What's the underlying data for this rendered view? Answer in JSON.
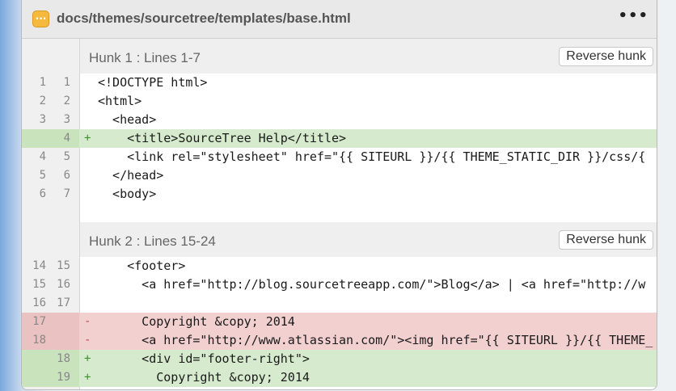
{
  "file": {
    "path": "docs/themes/sourcetree/templates/base.html",
    "icon": "ellipsis-file-icon",
    "menu": "•••"
  },
  "hunks": [
    {
      "title": "Hunk 1 : Lines 1-7",
      "button": "Reverse hunk",
      "lines": [
        {
          "old": "1",
          "new": "1",
          "type": "ctx",
          "sign": "",
          "text": "<!DOCTYPE html>"
        },
        {
          "old": "2",
          "new": "2",
          "type": "ctx",
          "sign": "",
          "text": "<html>"
        },
        {
          "old": "3",
          "new": "3",
          "type": "ctx",
          "sign": "",
          "text": "  <head>"
        },
        {
          "old": "",
          "new": "4",
          "type": "add",
          "sign": "+",
          "text": "    <title>SourceTree Help</title>"
        },
        {
          "old": "4",
          "new": "5",
          "type": "ctx",
          "sign": "",
          "text": "    <link rel=\"stylesheet\" href=\"{{ SITEURL }}/{{ THEME_STATIC_DIR }}/css/{"
        },
        {
          "old": "5",
          "new": "6",
          "type": "ctx",
          "sign": "",
          "text": "  </head>"
        },
        {
          "old": "6",
          "new": "7",
          "type": "ctx",
          "sign": "",
          "text": "  <body>"
        }
      ]
    },
    {
      "title": "Hunk 2 : Lines 15-24",
      "button": "Reverse hunk",
      "lines": [
        {
          "old": "14",
          "new": "15",
          "type": "ctx",
          "sign": "",
          "text": "    <footer>"
        },
        {
          "old": "15",
          "new": "16",
          "type": "ctx",
          "sign": "",
          "text": "      <a href=\"http://blog.sourcetreeapp.com/\">Blog</a> | <a href=\"http://w"
        },
        {
          "old": "16",
          "new": "17",
          "type": "ctx",
          "sign": "",
          "text": ""
        },
        {
          "old": "17",
          "new": "",
          "type": "del",
          "sign": "-",
          "text": "      Copyright &copy; 2014"
        },
        {
          "old": "18",
          "new": "",
          "type": "del",
          "sign": "-",
          "text": "      <a href=\"http://www.atlassian.com/\"><img href=\"{{ SITEURL }}/{{ THEME_"
        },
        {
          "old": "",
          "new": "18",
          "type": "add",
          "sign": "+",
          "text": "      <div id=\"footer-right\">"
        },
        {
          "old": "",
          "new": "19",
          "type": "add",
          "sign": "+",
          "text": "        Copyright &copy; 2014"
        }
      ]
    }
  ]
}
